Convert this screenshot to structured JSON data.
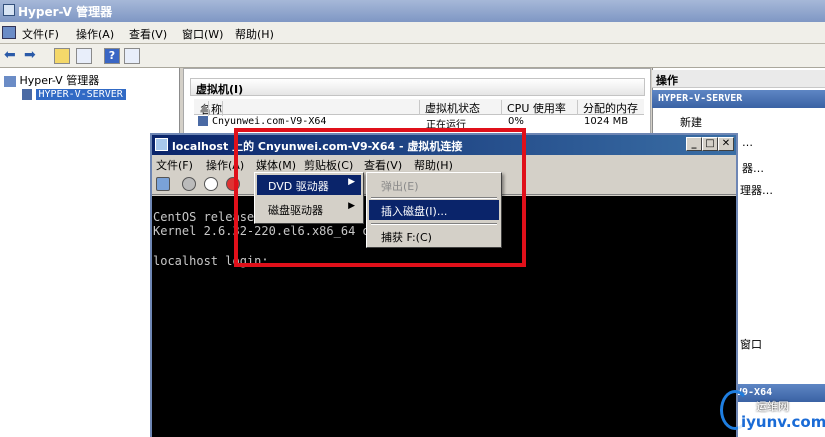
{
  "outer": {
    "title": "Hyper-V 管理器",
    "menu": [
      "文件(F)",
      "操作(A)",
      "查看(V)",
      "窗口(W)",
      "帮助(H)"
    ]
  },
  "tree": {
    "root": "Hyper-V 管理器",
    "server": "HYPER-V-SERVER"
  },
  "vm_panel": {
    "header": "虚拟机(I)",
    "columns": [
      "名称",
      "虚拟机状态",
      "CPU 使用率",
      "分配的内存"
    ],
    "rows": [
      {
        "name": "Cnyunwei.com-V9-X64",
        "state": "正在运行",
        "cpu": "0%",
        "memory": "1024 MB"
      }
    ]
  },
  "actions": {
    "title": "操作",
    "server_header": "HYPER-V-SERVER",
    "items": [
      "新建",
      "…",
      "器…",
      "理器…",
      "窗口"
    ],
    "vm_header": "V9-X64"
  },
  "vm_window": {
    "title": "localhost 上的 Cnyunwei.com-V9-X64 - 虚拟机连接",
    "menu": [
      "文件(F)",
      "操作(A)",
      "媒体(M)",
      "剪贴板(C)",
      "查看(V)",
      "帮助(H)"
    ],
    "console_lines": [
      "CentOS release 6.2 (Final)",
      "Kernel 2.6.32-220.el6.x86_64 on an x86_64",
      "",
      "localhost login:"
    ],
    "media_menu": [
      "DVD 驱动器",
      "磁盘驱动器"
    ],
    "dvd_submenu": [
      "弹出(E)",
      "插入磁盘(I)...",
      "捕获 F:(C)"
    ]
  },
  "watermark": {
    "sub": "运维网",
    "main": "iyunv.com"
  },
  "colors": {
    "highlight": "#e0101a",
    "selection": "#0a246a",
    "title_bar": "#0a246a"
  }
}
